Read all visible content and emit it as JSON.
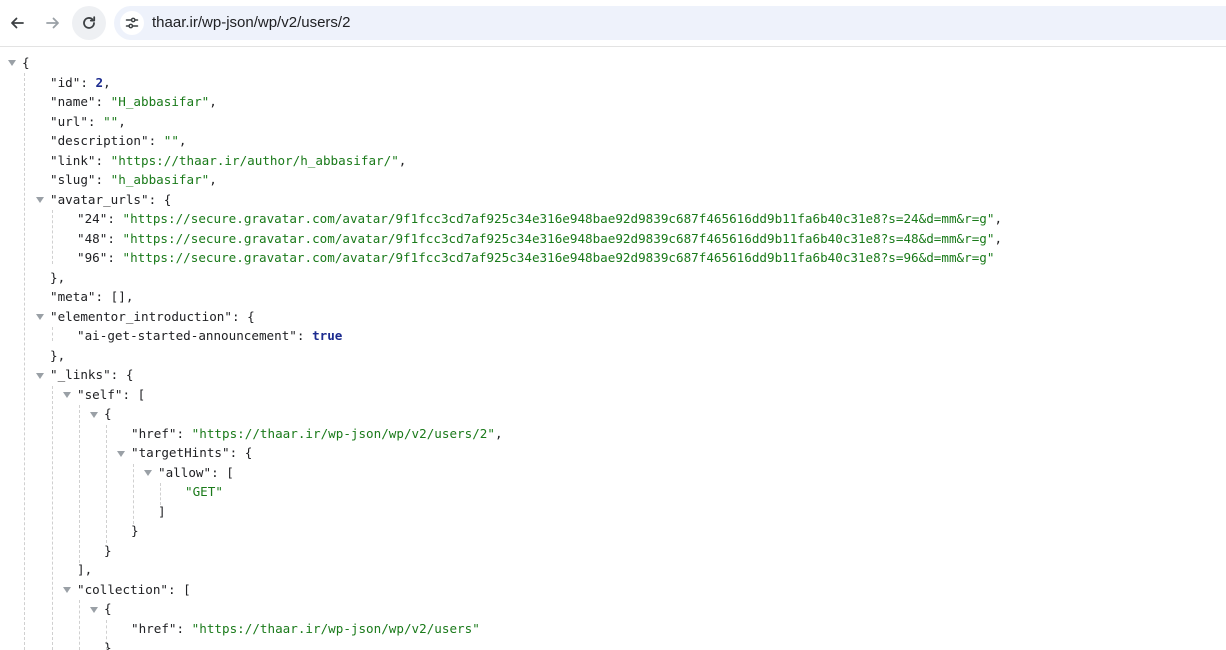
{
  "browser": {
    "url": "thaar.ir/wp-json/wp/v2/users/2"
  },
  "json": {
    "open_brace": "{",
    "id_key": "\"id\"",
    "id_value": "2",
    "name_key": "\"name\"",
    "name_value": "\"H_abbasifar\"",
    "url_key": "\"url\"",
    "url_value": "\"\"",
    "description_key": "\"description\"",
    "description_value": "\"\"",
    "link_key": "\"link\"",
    "link_value": "\"https://thaar.ir/author/h_abbasifar/\"",
    "slug_key": "\"slug\"",
    "slug_value": "\"h_abbasifar\"",
    "avatar_urls_key": "\"avatar_urls\"",
    "avatar_24_key": "\"24\"",
    "avatar_24_value": "\"https://secure.gravatar.com/avatar/9f1fcc3cd7af925c34e316e948bae92d9839c687f465616dd9b11fa6b40c31e8?s=24&d=mm&r=g\"",
    "avatar_48_key": "\"48\"",
    "avatar_48_value": "\"https://secure.gravatar.com/avatar/9f1fcc3cd7af925c34e316e948bae92d9839c687f465616dd9b11fa6b40c31e8?s=48&d=mm&r=g\"",
    "avatar_96_key": "\"96\"",
    "avatar_96_value": "\"https://secure.gravatar.com/avatar/9f1fcc3cd7af925c34e316e948bae92d9839c687f465616dd9b11fa6b40c31e8?s=96&d=mm&r=g\"",
    "meta_key": "\"meta\"",
    "meta_value": "[],",
    "elementor_key": "\"elementor_introduction\"",
    "ai_key": "\"ai-get-started-announcement\"",
    "ai_value": "true",
    "links_key": "\"_links\"",
    "self_key": "\"self\"",
    "href_key": "\"href\"",
    "self_href_value": "\"https://thaar.ir/wp-json/wp/v2/users/2\"",
    "targethints_key": "\"targetHints\"",
    "allow_key": "\"allow\"",
    "allow_item": "\"GET\"",
    "collection_key": "\"collection\"",
    "collection_href_value": "\"https://thaar.ir/wp-json/wp/v2/users\""
  }
}
